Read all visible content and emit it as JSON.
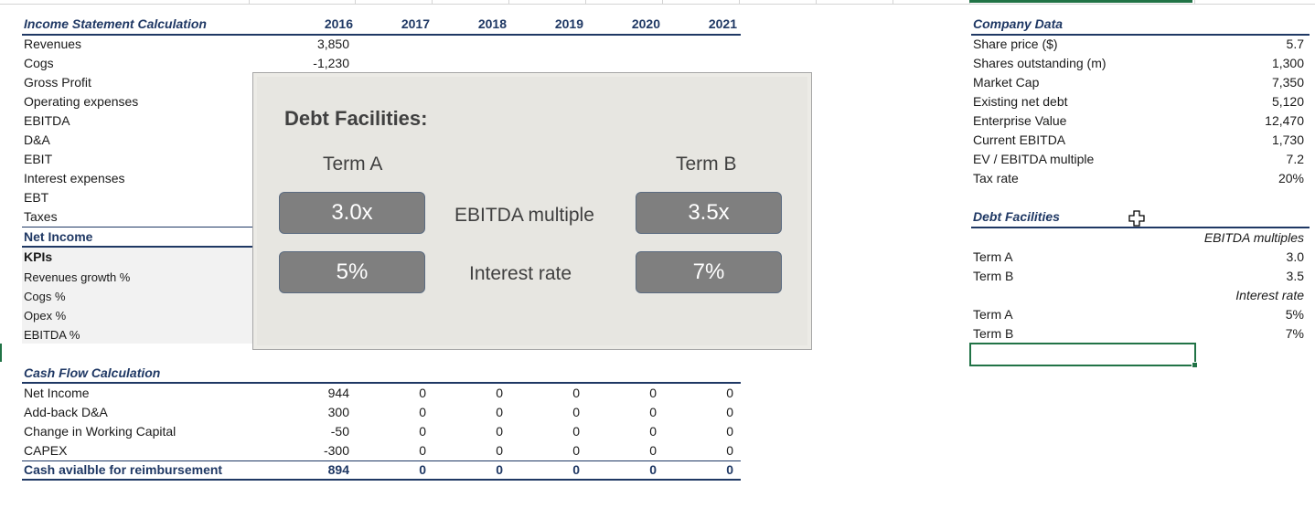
{
  "income": {
    "title": "Income Statement Calculation",
    "years": [
      "2016",
      "2017",
      "2018",
      "2019",
      "2020",
      "2021"
    ],
    "rows": [
      {
        "label": "Revenues",
        "v2016": "3,850"
      },
      {
        "label": "Cogs",
        "v2016": "-1,230"
      },
      {
        "label": "Gross Profit"
      },
      {
        "label": "Operating expenses"
      },
      {
        "label": "EBITDA"
      },
      {
        "label": "D&A"
      },
      {
        "label": "EBIT"
      },
      {
        "label": "Interest expenses"
      },
      {
        "label": "EBT"
      },
      {
        "label": "Taxes"
      }
    ],
    "net_income_label": "Net Income",
    "kpi_title": "KPIs",
    "kpis": [
      "Revenues growth %",
      "Cogs %",
      "Opex %",
      "EBITDA %"
    ]
  },
  "cashflow": {
    "title": "Cash Flow Calculation",
    "rows": [
      {
        "label": "Net Income",
        "values": [
          "944",
          "0",
          "0",
          "0",
          "0",
          "0"
        ]
      },
      {
        "label": "Add-back D&A",
        "values": [
          "300",
          "0",
          "0",
          "0",
          "0",
          "0"
        ]
      },
      {
        "label": "Change in Working Capital",
        "values": [
          "-50",
          "0",
          "0",
          "0",
          "0",
          "0"
        ]
      },
      {
        "label": "CAPEX",
        "values": [
          "-300",
          "0",
          "0",
          "0",
          "0",
          "0"
        ]
      }
    ],
    "total": {
      "label": "Cash avialble for reimbursement",
      "values": [
        "894",
        "0",
        "0",
        "0",
        "0",
        "0"
      ]
    }
  },
  "company": {
    "title": "Company Data",
    "rows": [
      {
        "label": "Share price ($)",
        "value": "5.7"
      },
      {
        "label": "Shares outstanding (m)",
        "value": "1,300"
      },
      {
        "label": "Market Cap",
        "value": "7,350"
      },
      {
        "label": "Existing net debt",
        "value": "5,120"
      },
      {
        "label": "Enterprise Value",
        "value": "12,470"
      },
      {
        "label": "Current EBITDA",
        "value": "1,730"
      },
      {
        "label": "EV / EBITDA multiple",
        "value": "7.2"
      },
      {
        "label": "Tax rate",
        "value": "20%"
      }
    ]
  },
  "facilities": {
    "title": "Debt Facilities",
    "multiples_header": "EBITDA multiples",
    "multiples": [
      {
        "label": "Term A",
        "value": "3.0"
      },
      {
        "label": "Term B",
        "value": "3.5"
      }
    ],
    "rate_header": "Interest rate",
    "rates": [
      {
        "label": "Term A",
        "value": "5%"
      },
      {
        "label": "Term B",
        "value": "7%"
      }
    ]
  },
  "panel": {
    "title": "Debt Facilities:",
    "term_a": "Term A",
    "term_b": "Term B",
    "multiple_label": "EBITDA multiple",
    "rate_label": "Interest rate",
    "a_multiple": "3.0x",
    "b_multiple": "3.5x",
    "a_rate": "5%",
    "b_rate": "7%"
  },
  "colors": {
    "accent_navy": "#1f3864",
    "excel_green": "#217346",
    "panel_bg": "#e7e6e1",
    "box_gray": "#7f7f7f"
  }
}
